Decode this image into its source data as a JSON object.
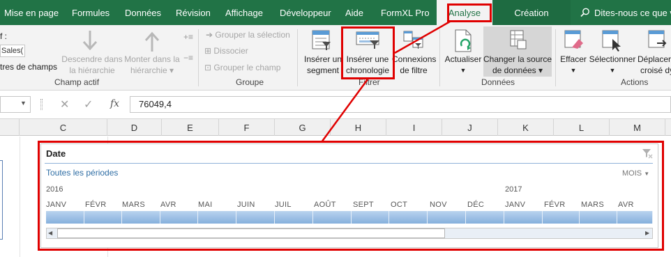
{
  "tabs": [
    "Mise en page",
    "Formules",
    "Données",
    "Révision",
    "Affichage",
    "Développeur",
    "Aide",
    "FormXL Pro",
    "Analyse",
    "Création"
  ],
  "tell_me": "Dites-nous ce que vo",
  "ribbon": {
    "field_label": "f :",
    "field_value": "Sales(",
    "field_settings": "tres de champs",
    "drill_down": [
      "Descendre dans",
      "la hiérarchie"
    ],
    "drill_up": [
      "Monter dans la",
      "hiérarchie"
    ],
    "group_selection": "Grouper la sélection",
    "ungroup": "Dissocier",
    "group_field": "Grouper le champ",
    "insert_slicer": [
      "Insérer un",
      "segment"
    ],
    "insert_timeline": [
      "Insérer une",
      "chronologie"
    ],
    "filter_connections": [
      "Connexions",
      "de filtre"
    ],
    "refresh": "Actualiser",
    "change_source": [
      "Changer la source",
      "de données"
    ],
    "clear": "Effacer",
    "select": "Sélectionner",
    "move": [
      "Déplacer",
      "croisé dy"
    ],
    "groups": {
      "active_field": "Champ actif",
      "group": "Groupe",
      "filter": "Filtrer",
      "data": "Données",
      "actions": "Actions"
    }
  },
  "formula": {
    "cancel": "✕",
    "enter": "✓",
    "fx": "fx",
    "value": "76049,4"
  },
  "columns": [
    "C",
    "D",
    "E",
    "F",
    "G",
    "H",
    "I",
    "J",
    "K",
    "L",
    "M"
  ],
  "timeline": {
    "title": "Date",
    "all_periods": "Toutes les périodes",
    "level": "MOIS",
    "years": [
      "2016",
      "2017"
    ],
    "months": [
      "JANV",
      "FÉVR",
      "MARS",
      "AVR",
      "MAI",
      "JUIN",
      "JUIL",
      "AOÛT",
      "SEPT",
      "OCT",
      "NOV",
      "DÉC",
      "JANV",
      "FÉVR",
      "MARS",
      "AVR"
    ]
  },
  "colors": {
    "excel_green": "#217346",
    "highlight_red": "#e00000",
    "timeline_blue": "#86b0dd",
    "link_blue": "#2e6da4"
  }
}
